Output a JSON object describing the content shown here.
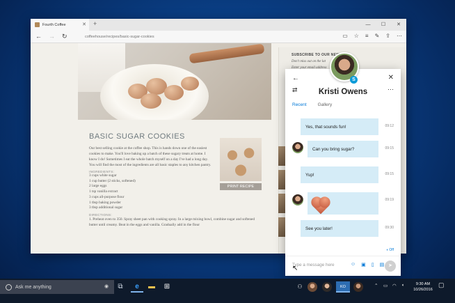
{
  "browser": {
    "tab_title": "Fourth Coffee",
    "tab_close": "✕",
    "new_tab": "+",
    "window_controls": [
      "—",
      "☐",
      "✕"
    ],
    "address": "coffeehouse/recipes/basic-sugar-cookies",
    "toolbar_icons": [
      "reading-view-icon",
      "favorite-star-icon",
      "hub-icon",
      "web-note-icon",
      "share-icon",
      "more-icon"
    ]
  },
  "page": {
    "recipe_title": "BASIC SUGAR COOKIES",
    "intro": "Our best selling cookie at the coffee shop. This is hands down one of the easiest cookies to make. You'll love baking up a batch of these sugary treats at home. I know I do! Sometimes I eat the whole batch myself on a day I've had a long day. You will find the most of the ingredients are all basic staples to any kitchen pantry.",
    "ingredients_label": "INGREDIENTS:",
    "ingredients": [
      "3 cups white sugar",
      "1 cup butter (2 sticks, softened)",
      "2 large eggs",
      "1 tsp vanilla extract",
      "3 cups all-purpose flour",
      "1 tbsp baking powder",
      "3 tbsp additional sugar"
    ],
    "directions_label": "DIRECTIONS:",
    "directions": "1.  Preheat oven to 350. Spray sheet pan with cooking spray. In a large mixing bowl, combine sugar and softened butter until creamy. Beat in the eggs and vanilla. Gradually add in the flour",
    "print_label": "PRINT RECIPE",
    "subscribe_title": "SUBSCRIBE TO OUR NEWS",
    "subscribe_line1": "Don't miss out on the lat",
    "subscribe_line2": "Enter your email address"
  },
  "skype": {
    "contact_name": "Kristi Owens",
    "tabs": [
      "Recent",
      "Gallery"
    ],
    "badge": "S",
    "messages": [
      {
        "text": "Yes, that sounds fun!",
        "time": "09:12"
      },
      {
        "text": "Can you bring sugar?",
        "time": "09:15"
      },
      {
        "text": "Yup!",
        "time": "09:15"
      },
      {
        "text": "",
        "time": "09:19"
      },
      {
        "text": "See you later!",
        "time": "09:30"
      }
    ],
    "status": "Off",
    "composer_placeholder": "Type a message here",
    "composer_icons": [
      "emoji-icon",
      "image-icon",
      "file-icon",
      "contact-card-icon"
    ]
  },
  "taskbar": {
    "search_placeholder": "Ask me anything",
    "people_badge": "KO",
    "time": "9:30 AM",
    "date": "10/26/2016"
  }
}
